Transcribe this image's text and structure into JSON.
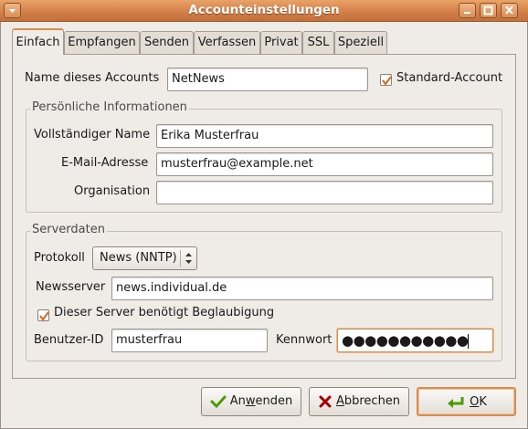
{
  "window": {
    "title": "Accounteinstellungen"
  },
  "tabs": [
    "Einfach",
    "Empfangen",
    "Senden",
    "Verfassen",
    "Privat",
    "SSL",
    "Speziell"
  ],
  "account": {
    "name_label": "Name dieses Accounts",
    "name_value": "NetNews",
    "default_label": "Standard-Account",
    "default_checked": true
  },
  "personal": {
    "legend": "Persönliche Informationen",
    "fullname_label": "Vollständiger Name",
    "fullname_value": "Erika Musterfrau",
    "email_label": "E-Mail-Adresse",
    "email_value": "musterfrau@example.net",
    "org_label": "Organisation",
    "org_value": ""
  },
  "server": {
    "legend": "Serverdaten",
    "protocol_label": "Protokoll",
    "protocol_value": "News (NNTP)",
    "newsserver_label": "Newsserver",
    "newsserver_value": "news.individual.de",
    "auth_label": "Dieser Server benötigt Beglaubigung",
    "auth_checked": true,
    "user_label": "Benutzer-ID",
    "user_value": "musterfrau",
    "password_label": "Kennwort",
    "password_value": "●●●●●●●●●●●"
  },
  "buttons": {
    "apply_pre": "An",
    "apply_key": "w",
    "apply_post": "enden",
    "cancel_pre": "",
    "cancel_key": "A",
    "cancel_post": "bbrechen",
    "ok_pre": "",
    "ok_key": "O",
    "ok_post": "K"
  },
  "colors": {
    "accent": "#e08a4c",
    "titlebar": "#d4804a"
  }
}
